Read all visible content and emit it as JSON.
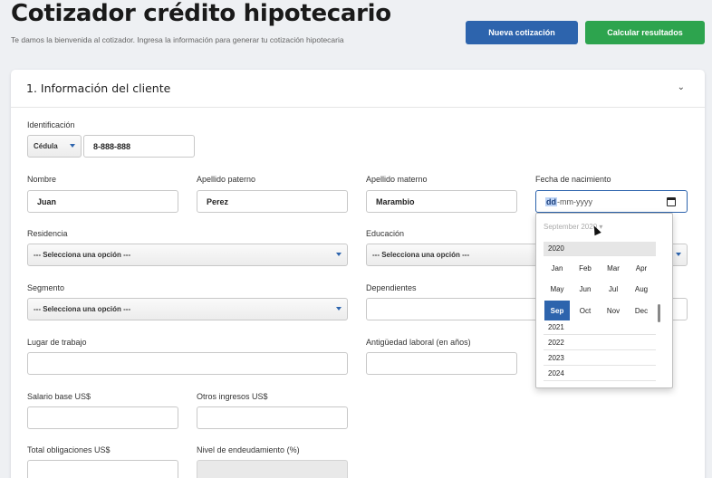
{
  "header": {
    "title": "Cotizador crédito hipotecario",
    "subtitle": "Te damos la bienvenida al cotizador. Ingresa la información para generar tu cotización hipotecaria",
    "btn_new": "Nueva cotización",
    "btn_calc": "Calcular resultados"
  },
  "section": {
    "title": "1. Información del cliente",
    "chevron": "⌄"
  },
  "form": {
    "id_label": "Identificación",
    "id_type": "Cédula",
    "id_value": "8-888-888",
    "nombre_label": "Nombre",
    "nombre_value": "Juan",
    "ap_pat_label": "Apellido paterno",
    "ap_pat_value": "Perez",
    "ap_mat_label": "Apellido materno",
    "ap_mat_value": "Marambio",
    "fecha_label": "Fecha de nacimiento",
    "fecha_dd": "dd",
    "fecha_rest": "-mm-yyyy",
    "residencia_label": "Residencia",
    "residencia_value": "--- Selecciona una opción ---",
    "educacion_label": "Educación",
    "educacion_value": "--- Selecciona una opción ---",
    "segmento_label": "Segmento",
    "segmento_value": "--- Selecciona una opción ---",
    "dependientes_label": "Dependientes",
    "lugar_label": "Lugar de trabajo",
    "antiguedad_label": "Antigüedad laboral (en años)",
    "salario_label": "Salario base US$",
    "otros_label": "Otros ingresos US$",
    "obligaciones_label": "Total obligaciones US$",
    "endeudamiento_label": "Nivel de endeudamiento (%)"
  },
  "picker": {
    "header": "September 2020 ▾",
    "year_top": "2020",
    "months": [
      "Jan",
      "Feb",
      "Mar",
      "Apr",
      "May",
      "Jun",
      "Jul",
      "Aug",
      "Sep",
      "Oct",
      "Nov",
      "Dec"
    ],
    "selected_month": "Sep",
    "years_after": [
      "2021",
      "2022",
      "2023",
      "2024"
    ]
  },
  "colors": {
    "primary": "#2d64ad",
    "success": "#2da44e"
  }
}
